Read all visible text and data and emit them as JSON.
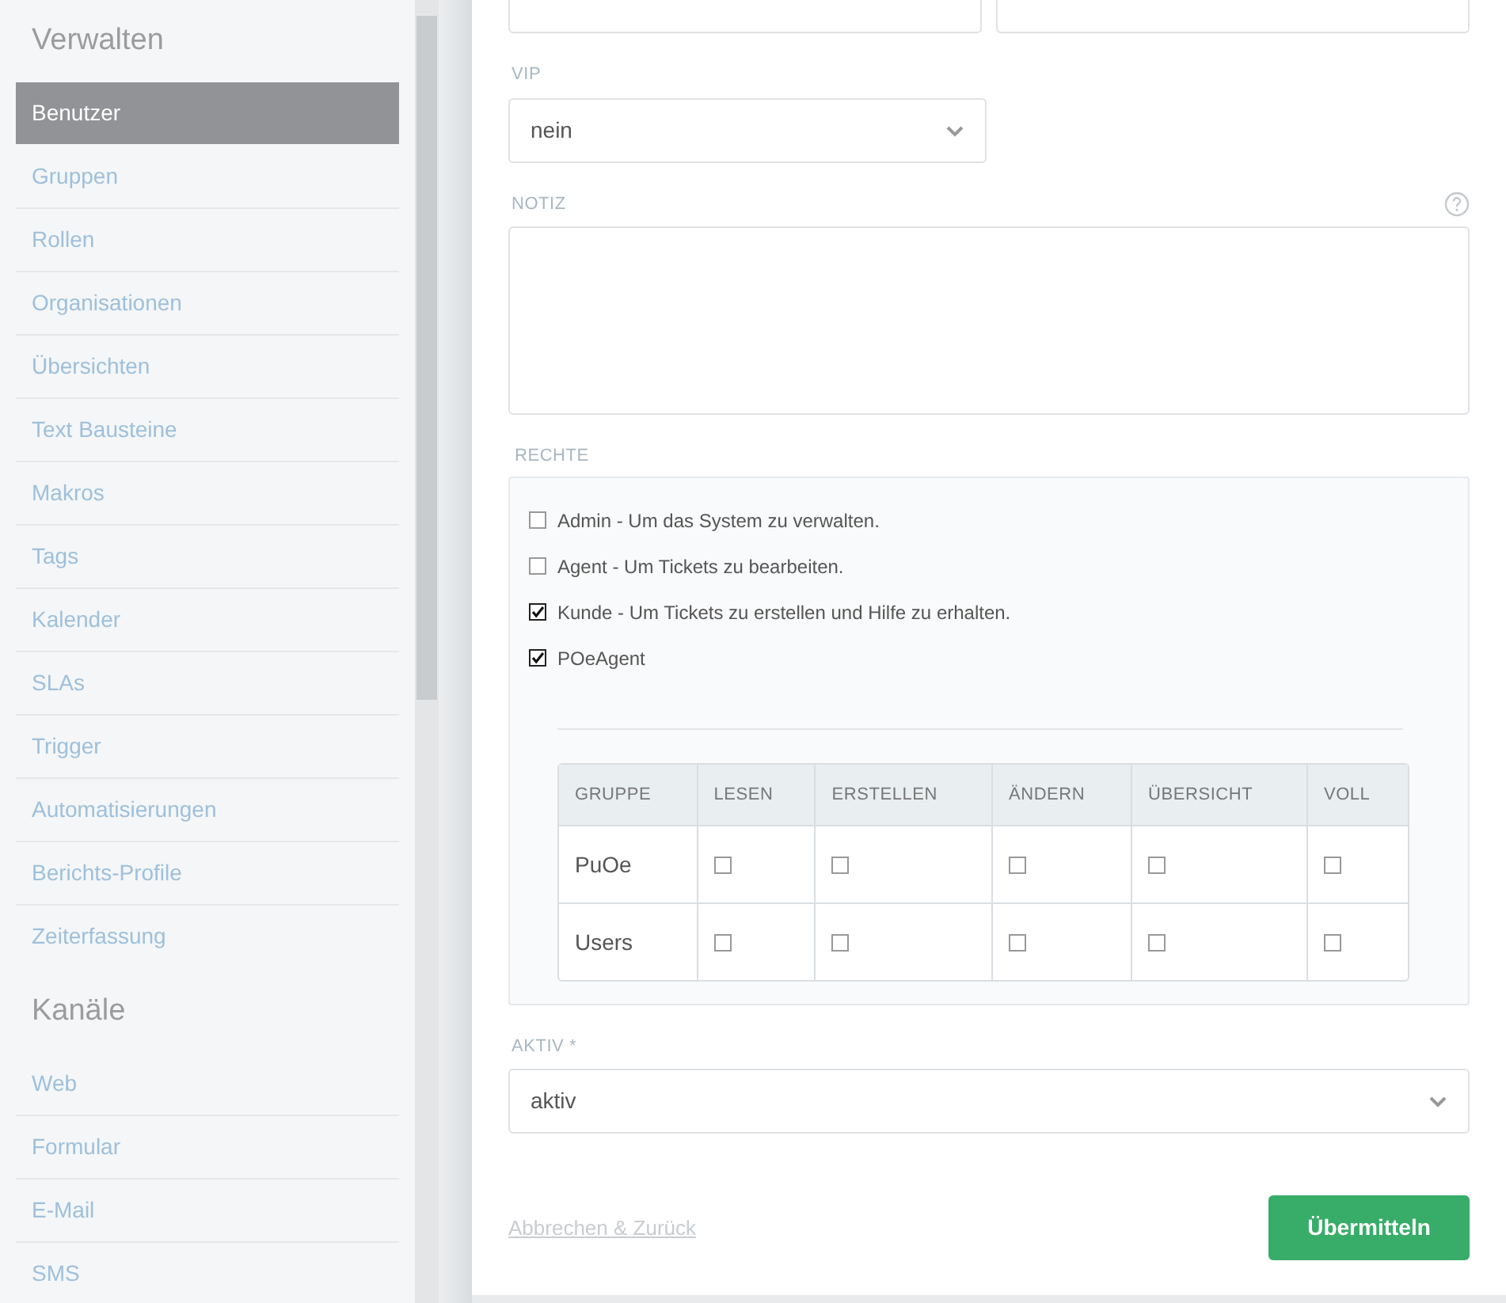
{
  "sidebar": {
    "sections": [
      {
        "title": "Verwalten",
        "items": [
          {
            "label": "Benutzer",
            "selected": true
          },
          {
            "label": "Gruppen",
            "selected": false
          },
          {
            "label": "Rollen",
            "selected": false
          },
          {
            "label": "Organisationen",
            "selected": false
          },
          {
            "label": "Übersichten",
            "selected": false
          },
          {
            "label": "Text Bausteine",
            "selected": false
          },
          {
            "label": "Makros",
            "selected": false
          },
          {
            "label": "Tags",
            "selected": false
          },
          {
            "label": "Kalender",
            "selected": false
          },
          {
            "label": "SLAs",
            "selected": false
          },
          {
            "label": "Trigger",
            "selected": false
          },
          {
            "label": "Automatisierungen",
            "selected": false
          },
          {
            "label": "Berichts-Profile",
            "selected": false
          },
          {
            "label": "Zeiterfassung",
            "selected": false
          }
        ]
      },
      {
        "title": "Kanäle",
        "items": [
          {
            "label": "Web",
            "selected": false
          },
          {
            "label": "Formular",
            "selected": false
          },
          {
            "label": "E-Mail",
            "selected": false
          },
          {
            "label": "SMS",
            "selected": false
          }
        ]
      }
    ]
  },
  "form": {
    "vip": {
      "label": "VIP",
      "value": "nein"
    },
    "note": {
      "label": "NOTIZ"
    },
    "rights": {
      "label": "RECHTE",
      "roles": [
        {
          "label": "Admin - Um das System zu verwalten.",
          "checked": false
        },
        {
          "label": "Agent - Um Tickets zu bearbeiten.",
          "checked": false
        },
        {
          "label": "Kunde - Um Tickets zu erstellen und Hilfe zu erhalten.",
          "checked": true
        },
        {
          "label": "POeAgent",
          "checked": true
        }
      ],
      "table": {
        "columns": [
          "GRUPPE",
          "LESEN",
          "ERSTELLEN",
          "ÄNDERN",
          "ÜBERSICHT",
          "VOLL"
        ],
        "rows": [
          {
            "group": "PuOe",
            "permissions": [
              false,
              false,
              false,
              false,
              false
            ]
          },
          {
            "group": "Users",
            "permissions": [
              false,
              false,
              false,
              false,
              false
            ]
          }
        ]
      }
    },
    "active": {
      "label": "AKTIV *",
      "value": "aktiv"
    },
    "cancel": "Abbrechen & Zurück",
    "submit": "Übermitteln"
  }
}
